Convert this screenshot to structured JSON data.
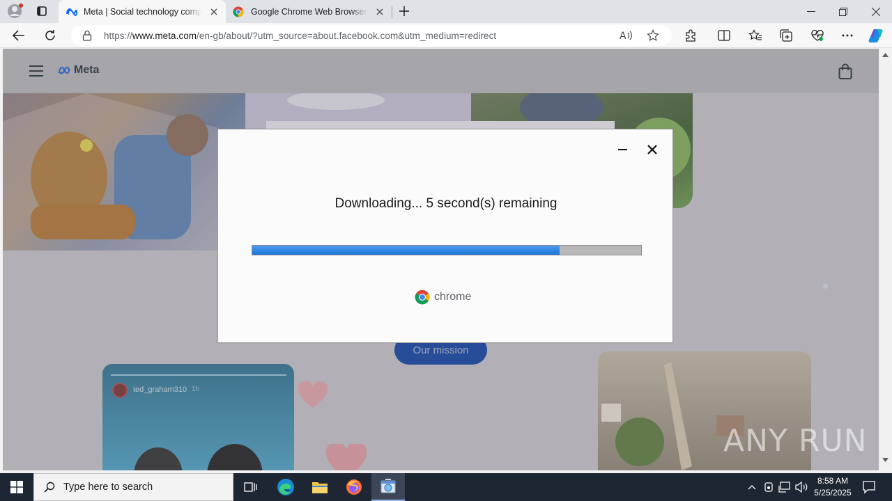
{
  "browser": {
    "tabs": [
      {
        "title": "Meta | Social technology company",
        "favicon": "meta-icon",
        "active": true
      },
      {
        "title": "Google Chrome Web Browser: Fi",
        "favicon": "chrome-icon",
        "active": false
      }
    ],
    "address": {
      "url_prefix": "https://",
      "url_host": "www.meta.com",
      "url_path": "/en-gb/about/?utm_source=about.facebook.com&utm_medium=redirect"
    }
  },
  "page": {
    "brand": "Meta",
    "mission_button": "Our mission",
    "post_username": "ted_graham310",
    "post_time": "1h"
  },
  "dialog": {
    "status_text": "Downloading... 5 second(s) remaining",
    "progress_fraction": 0.79,
    "brand_label": "chrome"
  },
  "taskbar": {
    "search_placeholder": "Type here to search",
    "time": "8:58 AM",
    "date": "5/25/2025"
  },
  "watermark": "ANY RUN",
  "colors": {
    "progress_fill": "#1e73d8",
    "mission_button": "#0b3ea3",
    "taskbar_bg": "#1f2633"
  }
}
